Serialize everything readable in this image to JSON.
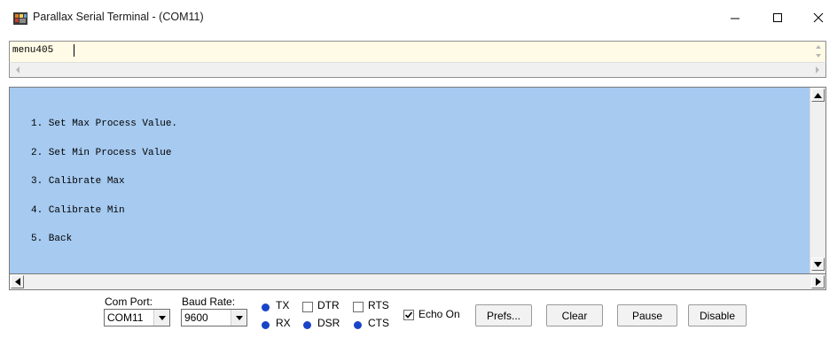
{
  "window": {
    "title": "Parallax Serial Terminal - (COM11)",
    "app_icon": "parallax-propeller-icon",
    "controls": [
      "minimize-icon",
      "maximize-icon",
      "close-icon"
    ]
  },
  "transmit": {
    "value": "menu405"
  },
  "receive": {
    "background": "#a6caf0",
    "lines": [
      "1. Set Max Process Value.",
      "2. Set Min Process Value",
      "3. Calibrate Max",
      "4. Calibrate Min",
      "5. Back"
    ]
  },
  "bottom": {
    "com_port": {
      "label": "Com Port:",
      "value": "COM11"
    },
    "baud_rate": {
      "label": "Baud Rate:",
      "value": "9600"
    },
    "indicators": {
      "tx": "TX",
      "rx": "RX",
      "dsr": "DSR",
      "cts": "CTS",
      "dtr": "DTR",
      "rts": "RTS",
      "led_color": "#1a44c8"
    },
    "echo_on": {
      "label": "Echo On",
      "checked": true
    },
    "buttons": {
      "prefs": "Prefs...",
      "clear": "Clear",
      "pause": "Pause",
      "disable": "Disable"
    }
  }
}
